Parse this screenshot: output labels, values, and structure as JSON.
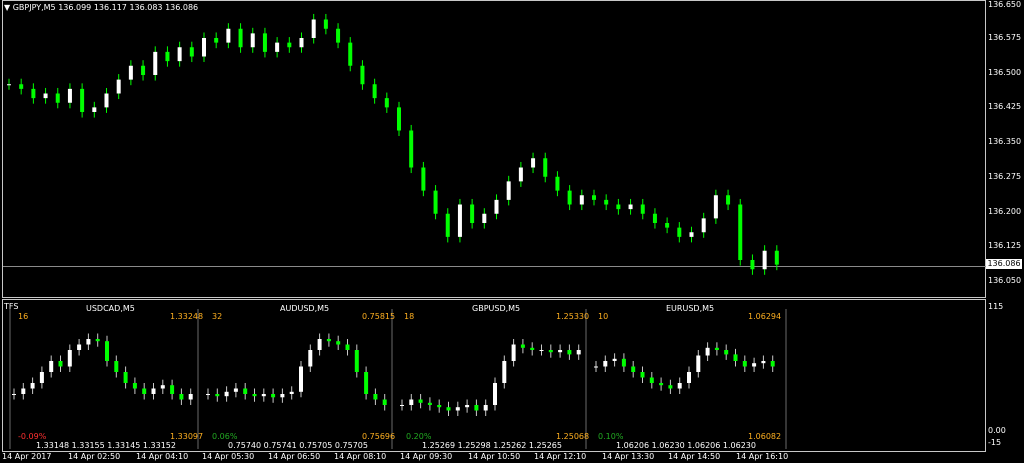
{
  "main_chart": {
    "header": "GBPJPY,M5  136.099 136.117 136.083 136.086",
    "current_price": "136.086",
    "y_axis_labels": [
      "136.650",
      "136.575",
      "136.500",
      "136.425",
      "136.350",
      "136.275",
      "136.200",
      "136.125",
      "136.050"
    ],
    "colors": {
      "up": "#ffffff",
      "down": "#00ff00",
      "wick": "#00ff00",
      "bg": "#000000"
    }
  },
  "indicator": {
    "name": "TFS",
    "y_axis_labels": [
      "115",
      "0.00",
      "-15"
    ],
    "panels": [
      {
        "symbol": "USDCAD,M5",
        "count": "16",
        "high": "1.33248",
        "low": "1.33097",
        "change": "-0.09%",
        "change_color": "#ff3030",
        "quotes": "1.33148  1.33155  1.33145  1.33152"
      },
      {
        "symbol": "AUDUSD,M5",
        "count": "32",
        "high": "0.75815",
        "low": "0.75696",
        "change": "0.06%",
        "change_color": "#22aa22",
        "quotes": "0.75740  0.75741  0.75705  0.75705"
      },
      {
        "symbol": "GBPUSD,M5",
        "count": "18",
        "high": "1.25330",
        "low": "1.25068",
        "change": "0.20%",
        "change_color": "#22aa22",
        "quotes": "1.25269  1.25298  1.25262  1.25265"
      },
      {
        "symbol": "EURUSD,M5",
        "count": "10",
        "high": "1.06294",
        "low": "1.06082",
        "change": "0.10%",
        "change_color": "#22aa22",
        "quotes": "1.06206  1.06230  1.06206  1.06230"
      }
    ]
  },
  "time_axis": [
    "14 Apr 2017",
    "14 Apr 02:50",
    "14 Apr 04:10",
    "14 Apr 05:30",
    "14 Apr 06:50",
    "14 Apr 08:10",
    "14 Apr 09:30",
    "14 Apr 10:50",
    "14 Apr 12:10",
    "14 Apr 13:30",
    "14 Apr 14:50",
    "14 Apr 16:10"
  ],
  "chart_data": {
    "type": "candlestick",
    "series": [
      {
        "name": "GBPJPY,M5",
        "close": [
          136.48,
          136.47,
          136.45,
          136.46,
          136.44,
          136.47,
          136.42,
          136.43,
          136.46,
          136.49,
          136.52,
          136.5,
          136.55,
          136.53,
          136.56,
          136.54,
          136.58,
          136.57,
          136.6,
          136.56,
          136.59,
          136.55,
          136.57,
          136.56,
          136.58,
          136.62,
          136.6,
          136.57,
          136.52,
          136.48,
          136.45,
          136.43,
          136.38,
          136.3,
          136.25,
          136.2,
          136.15,
          136.22,
          136.18,
          136.2,
          136.23,
          136.27,
          136.3,
          136.32,
          136.28,
          136.25,
          136.22,
          136.24,
          136.23,
          136.22,
          136.21,
          136.22,
          136.2,
          136.18,
          136.17,
          136.15,
          136.16,
          136.19,
          136.24,
          136.22,
          136.1,
          136.08,
          136.12,
          136.09
        ]
      }
    ]
  }
}
